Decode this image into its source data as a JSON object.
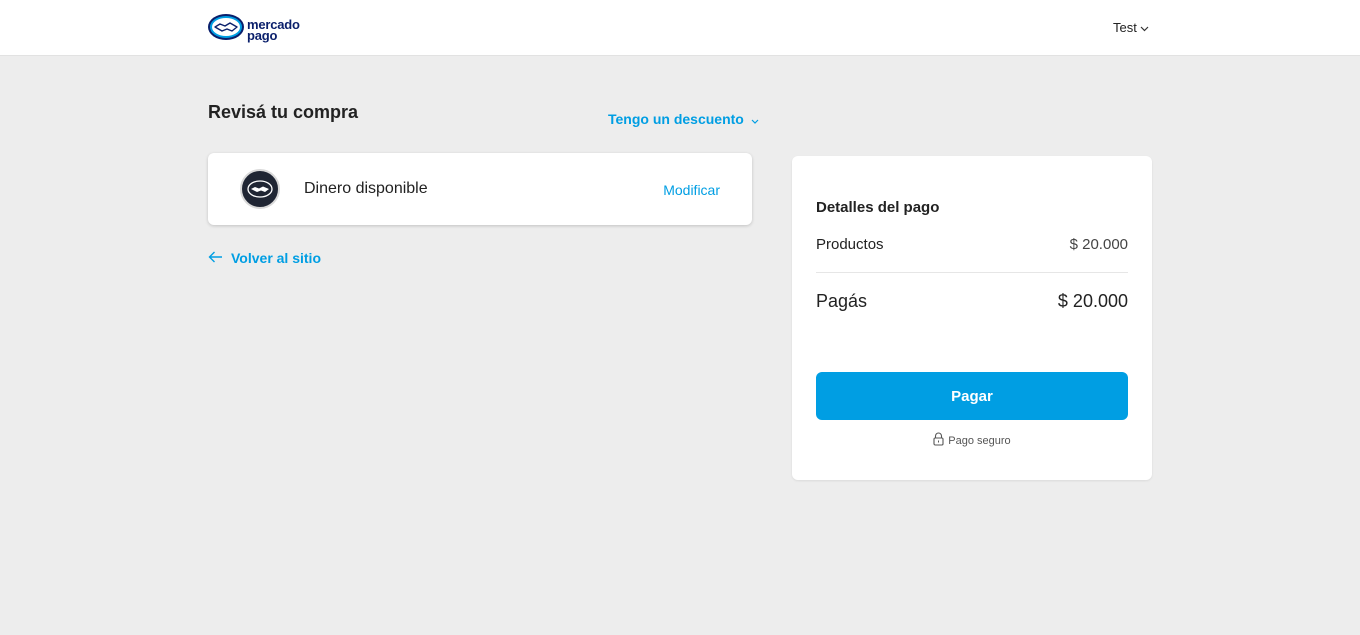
{
  "header": {
    "logo": {
      "line1": "mercado",
      "line2": "pago",
      "icon": "handshake-icon"
    },
    "user_menu": {
      "label": "Test",
      "icon": "chevron-down-icon"
    }
  },
  "main": {
    "title": "Revisá tu compra",
    "discount_link": {
      "label": "Tengo un descuento",
      "icon": "chevron-down-icon"
    },
    "payment_method": {
      "label": "Dinero disponible",
      "icon": "handshake-icon",
      "action_label": "Modificar"
    },
    "back_link": {
      "label": "Volver al sitio",
      "icon": "arrow-left-icon"
    }
  },
  "summary": {
    "title": "Detalles del pago",
    "products_label": "Productos",
    "products_value": "$ 20.000",
    "total_label": "Pagás",
    "total_value": "$ 20.000",
    "pay_button": "Pagar",
    "secure_label": "Pago seguro",
    "secure_icon": "lock-icon"
  },
  "colors": {
    "accent": "#009ee3",
    "background": "#ededed",
    "logo_blue": "#0a1f6b"
  }
}
